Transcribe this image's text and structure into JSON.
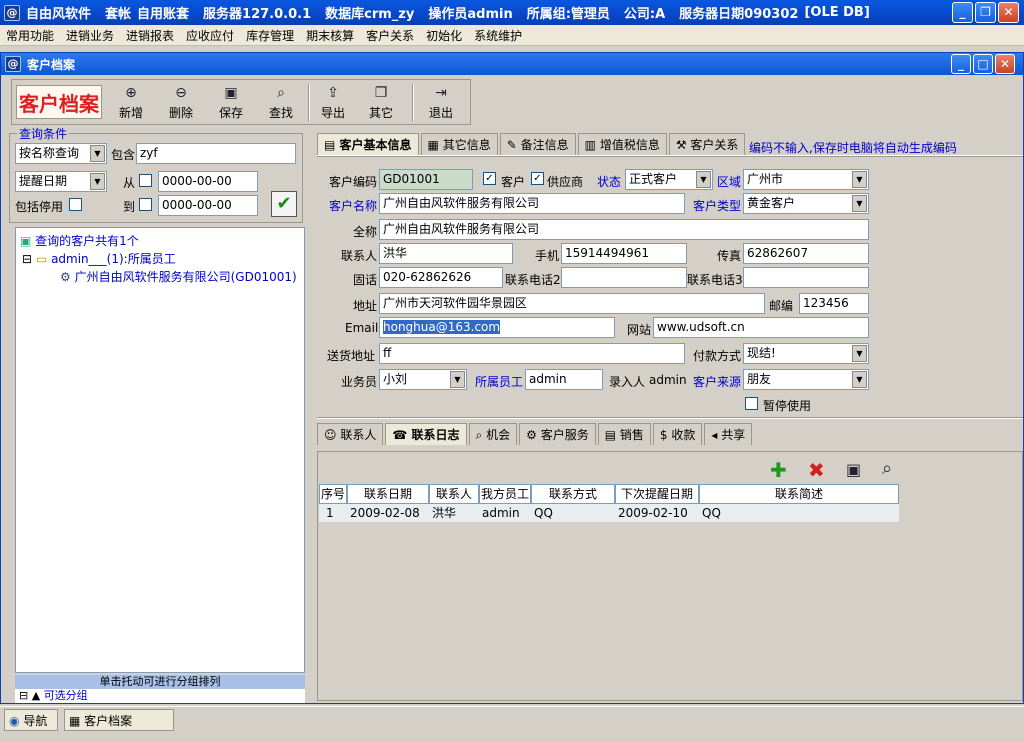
{
  "titlebar": {
    "app": "自由风软件",
    "account_label": "套帐",
    "account": "自用账套",
    "server": "服务器127.0.0.1",
    "database": "数据库crm_zy",
    "operator": "操作员admin",
    "group": "所属组:管理员",
    "company": "公司:A",
    "server_date": "服务器日期090302",
    "db_type": "[OLE DB]"
  },
  "menu": [
    "常用功能",
    "进销业务",
    "进销报表",
    "应收应付",
    "库存管理",
    "期末核算",
    "客户关系",
    "初始化",
    "系统维护"
  ],
  "doc_title": "客户档案",
  "toolbar": {
    "title": "客户档案",
    "buttons": [
      "新增",
      "删除",
      "保存",
      "查找",
      "导出",
      "其它",
      "退出"
    ]
  },
  "query": {
    "legend": "查询条件",
    "query_type": "按名称查询",
    "contains_label": "包含",
    "contains_value": "zyf",
    "date_type": "提醒日期",
    "from_label": "从",
    "from_value": "0000-00-00",
    "to_label": "到",
    "to_value": "0000-00-00",
    "include_disabled": "包括停用"
  },
  "tree": {
    "root": "查询的客户共有1个",
    "group": "admin___(1):所属员工",
    "leaf": "广州自由风软件服务有限公司(GD01001)"
  },
  "group_hint": "单击托动可进行分组排列",
  "group_opt": "可选分组",
  "tabs": [
    "客户基本信息",
    "其它信息",
    "备注信息",
    "增值税信息",
    "客户关系"
  ],
  "hint": "编码不输入,保存时电脑将自动生成编码",
  "form": {
    "code_label": "客户编码",
    "code": "GD01001",
    "customer_chk": "客户",
    "supplier_chk": "供应商",
    "status_label": "状态",
    "status": "正式客户",
    "region_label": "区域",
    "region": "广州市",
    "name_label": "客户名称",
    "name": "广州自由风软件服务有限公司",
    "type_label": "客户类型",
    "type": "黄金客户",
    "fullname_label": "全称",
    "fullname": "广州自由风软件服务有限公司",
    "contact_label": "联系人",
    "contact": "洪华",
    "mobile_label": "手机",
    "mobile": "15914494961",
    "fax_label": "传真",
    "fax": "62862607",
    "phone_label": "固话",
    "phone": "020-62862626",
    "phone2_label": "联系电话2",
    "phone3_label": "联系电话3",
    "address_label": "地址",
    "address": "广州市天河软件园华景园区",
    "zip_label": "邮编",
    "zip": "123456",
    "email_label": "Email",
    "email": "honghua@163.com",
    "web_label": "网站",
    "web": "www.udsoft.cn",
    "ship_label": "送货地址",
    "ship": "ff",
    "pay_label": "付款方式",
    "pay": "现结!",
    "sales_label": "业务员",
    "sales": "小刘",
    "staff_label": "所属员工",
    "staff": "admin",
    "entered_label": "录入人",
    "entered": "admin",
    "source_label": "客户来源",
    "source": "朋友",
    "suspend": "暂停使用"
  },
  "subtabs": [
    "联系人",
    "联系日志",
    "机会",
    "客户服务",
    "销售",
    "收款",
    "共享"
  ],
  "grid": {
    "headers": [
      "序号",
      "联系日期",
      "联系人",
      "我方员工",
      "联系方式",
      "下次提醒日期",
      "联系简述"
    ],
    "rows": [
      [
        "1",
        "2009-02-08",
        "洪华",
        "admin",
        "QQ",
        "2009-02-10",
        "QQ"
      ]
    ]
  },
  "status": {
    "nav": "导航",
    "doc": "客户档案"
  }
}
